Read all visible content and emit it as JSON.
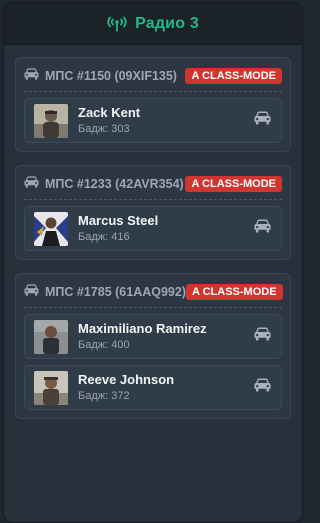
{
  "header": {
    "title": "Радио 3",
    "icon": "radio-tower-icon",
    "accent": "#22b98a"
  },
  "groups": [
    {
      "title": "МПС #1150 (09XIF135)",
      "badge": "A CLASS-MODE",
      "members": [
        {
          "name": "Zack Kent",
          "badge_text": "Бадж: 303"
        }
      ]
    },
    {
      "title": "МПС #1233 (42AVR354)",
      "badge": "A CLASS-MODE",
      "members": [
        {
          "name": "Marcus Steel",
          "badge_text": "Бадж: 416"
        }
      ]
    },
    {
      "title": "МПС #1785 (61AAQ992)",
      "badge": "A CLASS-MODE",
      "members": [
        {
          "name": "Maximiliano Ramirez",
          "badge_text": "Бадж: 400"
        },
        {
          "name": "Reeve Johnson",
          "badge_text": "Бадж: 372"
        }
      ]
    }
  ],
  "colors": {
    "badge_bg": "#d0352f",
    "panel_bg": "#27313b"
  },
  "icons": {
    "vehicle": "car-icon",
    "member_vehicle": "car-icon"
  }
}
